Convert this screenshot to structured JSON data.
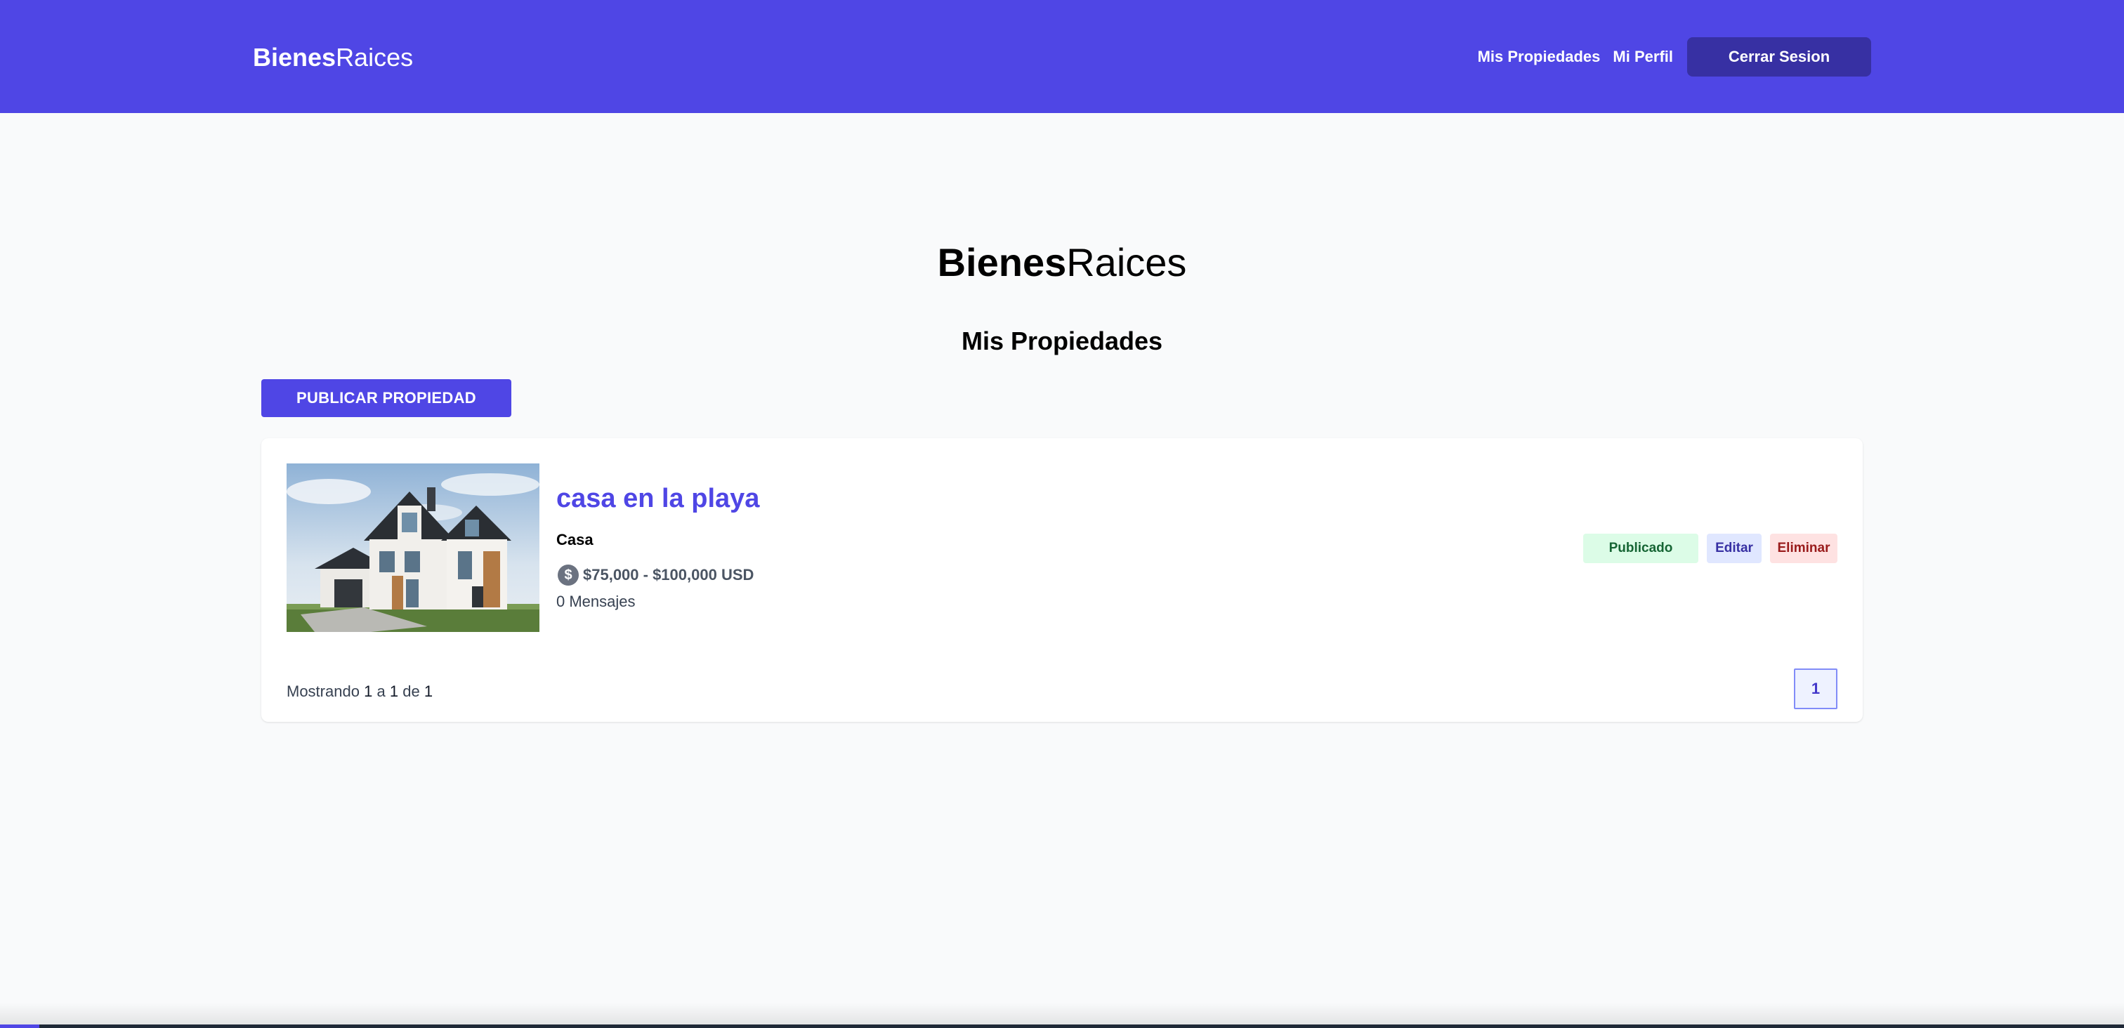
{
  "header": {
    "logo_bold": "Bienes",
    "logo_light": "Raices",
    "nav": {
      "my_properties": "Mis Propiedades",
      "my_profile": "Mi Perfil",
      "logout": "Cerrar Sesion"
    }
  },
  "main": {
    "logo_bold": "Bienes",
    "logo_light": "Raices",
    "title": "Mis Propiedades",
    "publish_button": "PUBLICAR PROPIEDAD"
  },
  "properties": [
    {
      "title": "casa en la playa",
      "category": "Casa",
      "price": "$75,000 - $100,000 USD",
      "messages": "0 Mensajes",
      "status": "Publicado",
      "edit_label": "Editar",
      "delete_label": "Eliminar",
      "image_icon": "house-photo"
    }
  ],
  "pagination": {
    "prefix": "Mostrando",
    "from": "1",
    "sep1": "a",
    "to": "1",
    "sep2": "de",
    "total": "1",
    "current_page": "1"
  },
  "colors": {
    "primary": "#4f46e5",
    "primary_dark": "#3730a3",
    "background": "#f9fafb",
    "published_bg": "#dcfce7",
    "published_text": "#166534",
    "delete_bg": "#fee2e2",
    "delete_text": "#991b1b"
  }
}
